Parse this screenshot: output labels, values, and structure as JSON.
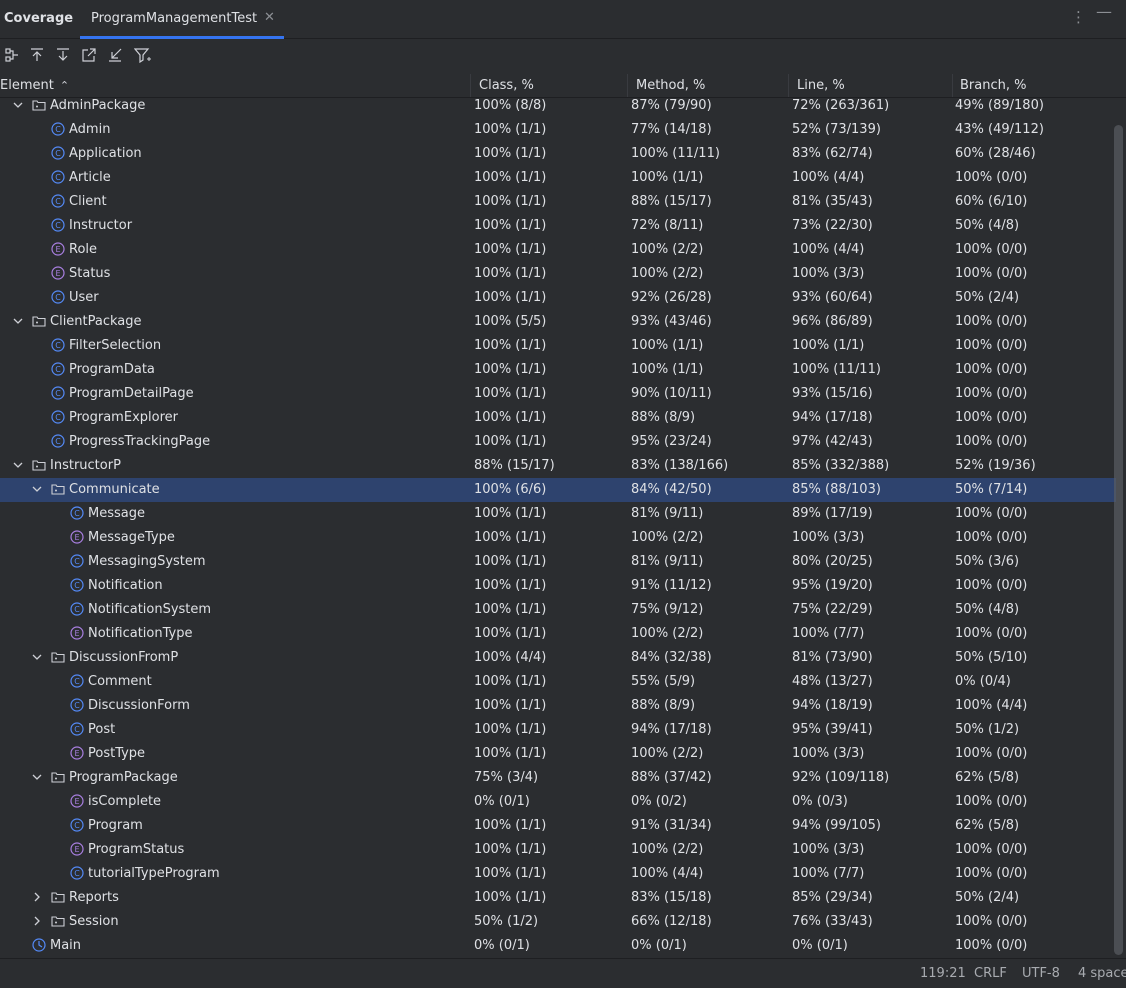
{
  "toolwindow": {
    "title": "Coverage",
    "tab_label": "ProgramManagementTest"
  },
  "toolbar": {
    "icons": [
      "flatten-packages-icon",
      "navigate-up-icon",
      "navigate-down-icon",
      "export-icon",
      "import-icon",
      "filter-icon"
    ]
  },
  "columns": [
    "Element",
    "Class, %",
    "Method, %",
    "Line, %",
    "Branch, %"
  ],
  "rows": [
    {
      "name": "AdminPackage",
      "type": "package",
      "level": 0,
      "expanded": true,
      "class": "100% (8/8)",
      "method": "87% (79/90)",
      "line": "72% (263/361)",
      "branch": "49% (89/180)"
    },
    {
      "name": "Admin",
      "type": "class",
      "level": 1,
      "class": "100% (1/1)",
      "method": "77% (14/18)",
      "line": "52% (73/139)",
      "branch": "43% (49/112)"
    },
    {
      "name": "Application",
      "type": "class",
      "level": 1,
      "class": "100% (1/1)",
      "method": "100% (11/11)",
      "line": "83% (62/74)",
      "branch": "60% (28/46)"
    },
    {
      "name": "Article",
      "type": "class",
      "level": 1,
      "class": "100% (1/1)",
      "method": "100% (1/1)",
      "line": "100% (4/4)",
      "branch": "100% (0/0)"
    },
    {
      "name": "Client",
      "type": "class",
      "level": 1,
      "class": "100% (1/1)",
      "method": "88% (15/17)",
      "line": "81% (35/43)",
      "branch": "60% (6/10)"
    },
    {
      "name": "Instructor",
      "type": "class",
      "level": 1,
      "class": "100% (1/1)",
      "method": "72% (8/11)",
      "line": "73% (22/30)",
      "branch": "50% (4/8)"
    },
    {
      "name": "Role",
      "type": "enum",
      "level": 1,
      "class": "100% (1/1)",
      "method": "100% (2/2)",
      "line": "100% (4/4)",
      "branch": "100% (0/0)"
    },
    {
      "name": "Status",
      "type": "enum",
      "level": 1,
      "class": "100% (1/1)",
      "method": "100% (2/2)",
      "line": "100% (3/3)",
      "branch": "100% (0/0)"
    },
    {
      "name": "User",
      "type": "class",
      "level": 1,
      "class": "100% (1/1)",
      "method": "92% (26/28)",
      "line": "93% (60/64)",
      "branch": "50% (2/4)"
    },
    {
      "name": "ClientPackage",
      "type": "package",
      "level": 0,
      "expanded": true,
      "class": "100% (5/5)",
      "method": "93% (43/46)",
      "line": "96% (86/89)",
      "branch": "100% (0/0)"
    },
    {
      "name": "FilterSelection",
      "type": "class",
      "level": 1,
      "class": "100% (1/1)",
      "method": "100% (1/1)",
      "line": "100% (1/1)",
      "branch": "100% (0/0)"
    },
    {
      "name": "ProgramData",
      "type": "class",
      "level": 1,
      "class": "100% (1/1)",
      "method": "100% (1/1)",
      "line": "100% (11/11)",
      "branch": "100% (0/0)"
    },
    {
      "name": "ProgramDetailPage",
      "type": "class",
      "level": 1,
      "class": "100% (1/1)",
      "method": "90% (10/11)",
      "line": "93% (15/16)",
      "branch": "100% (0/0)"
    },
    {
      "name": "ProgramExplorer",
      "type": "class",
      "level": 1,
      "class": "100% (1/1)",
      "method": "88% (8/9)",
      "line": "94% (17/18)",
      "branch": "100% (0/0)"
    },
    {
      "name": "ProgressTrackingPage",
      "type": "class",
      "level": 1,
      "class": "100% (1/1)",
      "method": "95% (23/24)",
      "line": "97% (42/43)",
      "branch": "100% (0/0)"
    },
    {
      "name": "InstructorP",
      "type": "package",
      "level": 0,
      "expanded": true,
      "class": "88% (15/17)",
      "method": "83% (138/166)",
      "line": "85% (332/388)",
      "branch": "52% (19/36)"
    },
    {
      "name": "Communicate",
      "type": "package",
      "level": 1,
      "expanded": true,
      "selected": true,
      "class": "100% (6/6)",
      "method": "84% (42/50)",
      "line": "85% (88/103)",
      "branch": "50% (7/14)"
    },
    {
      "name": "Message",
      "type": "class",
      "level": 2,
      "class": "100% (1/1)",
      "method": "81% (9/11)",
      "line": "89% (17/19)",
      "branch": "100% (0/0)"
    },
    {
      "name": "MessageType",
      "type": "enum",
      "level": 2,
      "class": "100% (1/1)",
      "method": "100% (2/2)",
      "line": "100% (3/3)",
      "branch": "100% (0/0)"
    },
    {
      "name": "MessagingSystem",
      "type": "class",
      "level": 2,
      "class": "100% (1/1)",
      "method": "81% (9/11)",
      "line": "80% (20/25)",
      "branch": "50% (3/6)"
    },
    {
      "name": "Notification",
      "type": "class",
      "level": 2,
      "class": "100% (1/1)",
      "method": "91% (11/12)",
      "line": "95% (19/20)",
      "branch": "100% (0/0)"
    },
    {
      "name": "NotificationSystem",
      "type": "class",
      "level": 2,
      "class": "100% (1/1)",
      "method": "75% (9/12)",
      "line": "75% (22/29)",
      "branch": "50% (4/8)"
    },
    {
      "name": "NotificationType",
      "type": "enum",
      "level": 2,
      "class": "100% (1/1)",
      "method": "100% (2/2)",
      "line": "100% (7/7)",
      "branch": "100% (0/0)"
    },
    {
      "name": "DiscussionFromP",
      "type": "package",
      "level": 1,
      "expanded": true,
      "class": "100% (4/4)",
      "method": "84% (32/38)",
      "line": "81% (73/90)",
      "branch": "50% (5/10)"
    },
    {
      "name": "Comment",
      "type": "class",
      "level": 2,
      "class": "100% (1/1)",
      "method": "55% (5/9)",
      "line": "48% (13/27)",
      "branch": "0% (0/4)"
    },
    {
      "name": "DiscussionForm",
      "type": "class",
      "level": 2,
      "class": "100% (1/1)",
      "method": "88% (8/9)",
      "line": "94% (18/19)",
      "branch": "100% (4/4)"
    },
    {
      "name": "Post",
      "type": "class",
      "level": 2,
      "class": "100% (1/1)",
      "method": "94% (17/18)",
      "line": "95% (39/41)",
      "branch": "50% (1/2)"
    },
    {
      "name": "PostType",
      "type": "enum",
      "level": 2,
      "class": "100% (1/1)",
      "method": "100% (2/2)",
      "line": "100% (3/3)",
      "branch": "100% (0/0)"
    },
    {
      "name": "ProgramPackage",
      "type": "package",
      "level": 1,
      "expanded": true,
      "class": "75% (3/4)",
      "method": "88% (37/42)",
      "line": "92% (109/118)",
      "branch": "62% (5/8)"
    },
    {
      "name": "isComplete",
      "type": "enum",
      "level": 2,
      "class": "0% (0/1)",
      "method": "0% (0/2)",
      "line": "0% (0/3)",
      "branch": "100% (0/0)"
    },
    {
      "name": "Program",
      "type": "class",
      "level": 2,
      "class": "100% (1/1)",
      "method": "91% (31/34)",
      "line": "94% (99/105)",
      "branch": "62% (5/8)"
    },
    {
      "name": "ProgramStatus",
      "type": "enum",
      "level": 2,
      "class": "100% (1/1)",
      "method": "100% (2/2)",
      "line": "100% (3/3)",
      "branch": "100% (0/0)"
    },
    {
      "name": "tutorialTypeProgram",
      "type": "class",
      "level": 2,
      "class": "100% (1/1)",
      "method": "100% (4/4)",
      "line": "100% (7/7)",
      "branch": "100% (0/0)"
    },
    {
      "name": "Reports",
      "type": "package",
      "level": 1,
      "expanded": false,
      "class": "100% (1/1)",
      "method": "83% (15/18)",
      "line": "85% (29/34)",
      "branch": "50% (2/4)"
    },
    {
      "name": "Session",
      "type": "package",
      "level": 1,
      "expanded": false,
      "class": "50% (1/2)",
      "method": "66% (12/18)",
      "line": "76% (33/43)",
      "branch": "100% (0/0)"
    },
    {
      "name": "Main",
      "type": "main",
      "level": 0,
      "class": "0% (0/1)",
      "method": "0% (0/1)",
      "line": "0% (0/1)",
      "branch": "100% (0/0)"
    }
  ],
  "statusbar": {
    "position": "119:21",
    "line_ending": "CRLF",
    "encoding": "UTF-8",
    "indent": "4 space"
  },
  "colors": {
    "selection": "#2e436e",
    "class_icon": "#548af7",
    "enum_icon": "#a87fe0",
    "accent": "#3574f0"
  }
}
